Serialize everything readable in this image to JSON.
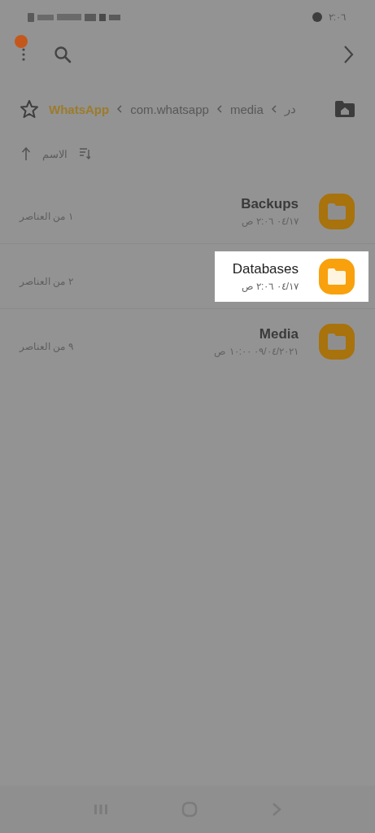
{
  "status_bar": {
    "time": "٢:٠٦"
  },
  "toolbar": {
    "menu_badge": true
  },
  "breadcrumb": [
    {
      "label": "در",
      "selected": false
    },
    {
      "label": "media",
      "selected": false
    },
    {
      "label": "com.whatsapp",
      "selected": false
    },
    {
      "label": "WhatsApp",
      "selected": true
    }
  ],
  "sort": {
    "label": "الاسم"
  },
  "rows": [
    {
      "name": "Backups",
      "date": "٠٤/١٧ ٢:٠٦ ص",
      "count": "١ من العناصر",
      "highlighted": false
    },
    {
      "name": "Databases",
      "date": "٠٤/١٧ ٢:٠٦ ص",
      "count": "٢ من العناصر",
      "highlighted": true
    },
    {
      "name": "Media",
      "date": "٠٩/٠٤/٢٠٢١ ١٠:٠٠ ص",
      "count": "٩ من العناصر",
      "highlighted": false
    }
  ]
}
